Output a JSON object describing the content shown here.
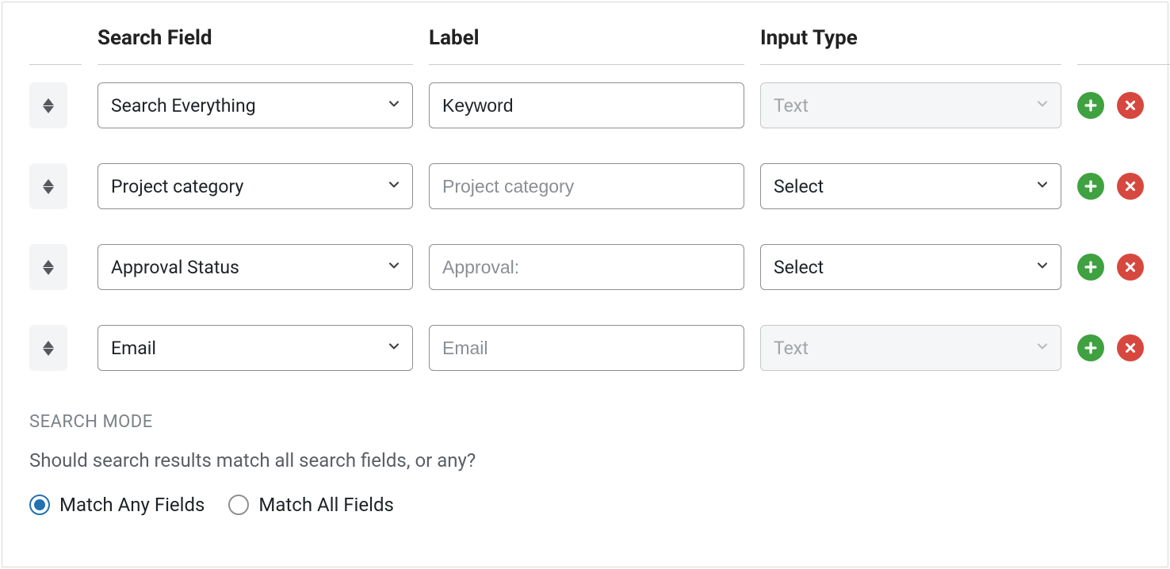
{
  "headers": {
    "search_field": "Search Field",
    "label": "Label",
    "input_type": "Input Type"
  },
  "rows": [
    {
      "search_field": "Search Everything",
      "label_value": "Keyword",
      "label_placeholder": "",
      "input_type": "Text",
      "input_type_disabled": true
    },
    {
      "search_field": "Project category",
      "label_value": "",
      "label_placeholder": "Project category",
      "input_type": "Select",
      "input_type_disabled": false
    },
    {
      "search_field": "Approval Status",
      "label_value": "",
      "label_placeholder": "Approval:",
      "input_type": "Select",
      "input_type_disabled": false
    },
    {
      "search_field": "Email",
      "label_value": "",
      "label_placeholder": "Email",
      "input_type": "Text",
      "input_type_disabled": true
    }
  ],
  "search_mode": {
    "title": "SEARCH MODE",
    "description": "Should search results match all search fields, or any?",
    "options": {
      "any": "Match Any Fields",
      "all": "Match All Fields"
    },
    "selected": "any"
  }
}
